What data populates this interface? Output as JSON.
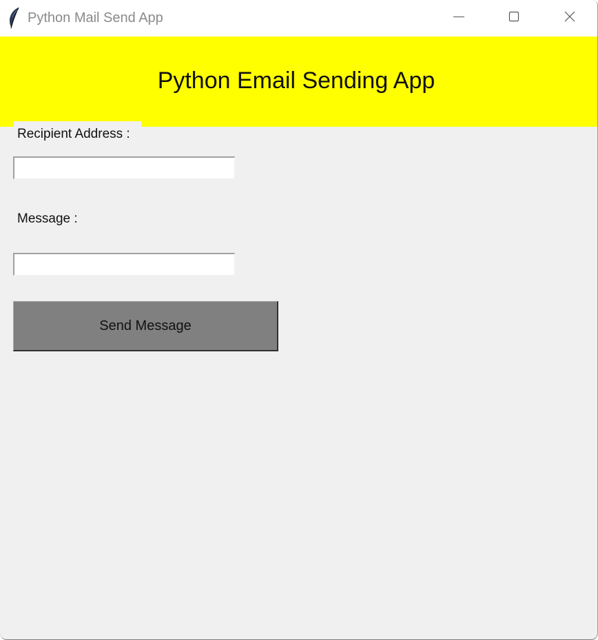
{
  "window": {
    "title": "Python Mail Send App",
    "controls": {
      "minimize_icon": "minimize-icon",
      "maximize_icon": "maximize-icon",
      "close_icon": "close-icon"
    },
    "app_icon": "feather-icon"
  },
  "header": {
    "title": "Python Email Sending App",
    "background_color": "#ffff00"
  },
  "form": {
    "recipient_label": "Recipient Address :",
    "recipient_value": "",
    "message_label": "Message :",
    "message_value": "",
    "send_label": "Send Message",
    "send_button_color": "#808080"
  }
}
